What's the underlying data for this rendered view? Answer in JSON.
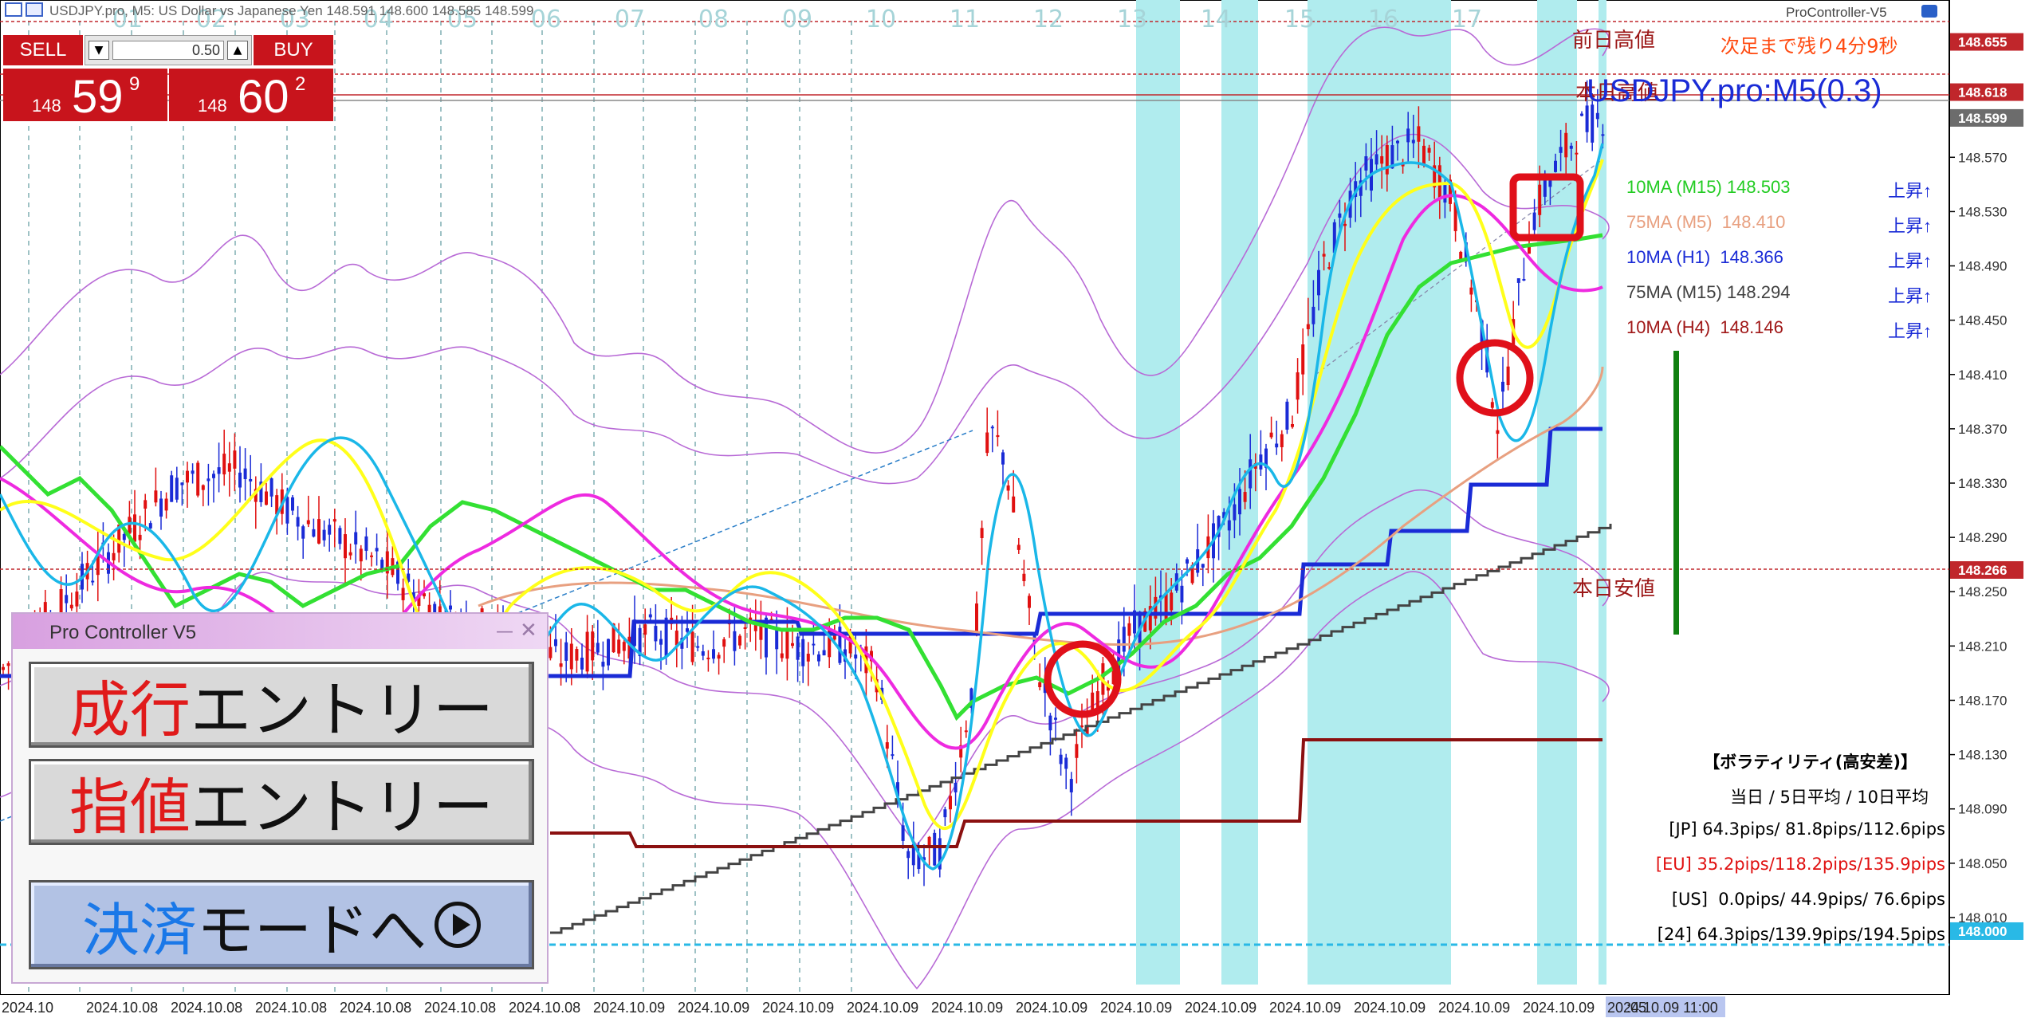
{
  "window": {
    "title_bar": "USDJPY.pro, M5: US Dollar vs Japanese Yen  148.591 148.600 148.585 148.599",
    "indicator_name": "ProController-V5"
  },
  "symbol_label": "USDJPY.pro:M5(0.3)",
  "countdown": "次足まで残り4分9秒",
  "trade_panel": {
    "sell_label": "SELL",
    "buy_label": "BUY",
    "lot": "0.50",
    "sell_price_big": "148",
    "sell_price_main": "59",
    "sell_price_sup": "9",
    "buy_price_big": "148",
    "buy_price_main": "60",
    "buy_price_sup": "2"
  },
  "controller": {
    "title": "Pro Controller V5",
    "btn1_red": "成行",
    "btn1_black": "エントリー",
    "btn2_red": "指値",
    "btn2_black": "エントリー",
    "btn3_blue": "決済",
    "btn3_black": "モードへ"
  },
  "levels": {
    "prev_day_high_label": "前日高値",
    "today_high_label": "本日高値",
    "today_low_label": "本日安値"
  },
  "ma_list": [
    {
      "label": "10MA (M15) 148.503",
      "status": "上昇↑",
      "color": "#22cc22"
    },
    {
      "label": "75MA (M5)  148.410",
      "status": "上昇↑",
      "color": "#e8a080"
    },
    {
      "label": "10MA (H1)  148.366",
      "status": "上昇↑",
      "color": "#1a2bd6"
    },
    {
      "label": "75MA (M15) 148.294",
      "status": "上昇↑",
      "color": "#404040"
    },
    {
      "label": "10MA (H4)  148.146",
      "status": "上昇↑",
      "color": "#a01818"
    }
  ],
  "volatility": {
    "title": "【ボラティリティ(高安差)】",
    "header": "当日 / 5日平均 / 10日平均",
    "rows": [
      {
        "text": "[JP] 64.3pips/ 81.8pips/112.6pips",
        "color": "#000000"
      },
      {
        "text": "[EU] 35.2pips/118.2pips/135.9pips",
        "color": "#e01010"
      },
      {
        "text": "[US]  0.0pips/ 44.9pips/ 76.6pips",
        "color": "#000000"
      },
      {
        "text": "[24] 64.3pips/139.9pips/194.5pips",
        "color": "#000000"
      }
    ]
  },
  "chart_data": {
    "type": "line",
    "title": "USDJPY.pro:M5(0.3)",
    "ylim": [
      147.99,
      148.67
    ],
    "y_ticks": [
      "148.570",
      "148.530",
      "148.490",
      "148.450",
      "148.410",
      "148.370",
      "148.330",
      "148.290",
      "148.250",
      "148.210",
      "148.170",
      "148.130",
      "148.090",
      "148.050",
      "148.010"
    ],
    "price_tags": [
      {
        "value": "148.655",
        "bg": "#c0262b"
      },
      {
        "value": "148.618",
        "bg": "#c0262b"
      },
      {
        "value": "148.599",
        "bg": "#6c6c6c"
      },
      {
        "value": "148.266",
        "bg": "#c0262b"
      },
      {
        "value": "148.000",
        "bg": "#29b9e6"
      }
    ],
    "hour_labels": [
      "01",
      "02",
      "03",
      "04",
      "05",
      "06",
      "07",
      "08",
      "09",
      "10",
      "11",
      "12",
      "13",
      "14",
      "15",
      "16",
      "17"
    ],
    "x_dates": [
      "2024.10",
      "2024.10.08",
      "2024.10.08",
      "2024.10.08",
      "2024.10.08",
      "2024.10.08",
      "2024.10.08",
      "2024.10.09",
      "2024.10.09",
      "2024.10.09",
      "2024.10.09",
      "2024.10.09",
      "2024.10.09",
      "2024.10.09",
      "2024.10.09",
      "2024.10.09",
      "2024.10.09",
      "2024.10.09",
      "2024.10.09",
      "2024.10.09 11:00"
    ],
    "x_tail": ":05",
    "series": [
      {
        "name": "10MA (M15)",
        "color": "#22dd22",
        "x": [
          0,
          20,
          40,
          60,
          80,
          100,
          120,
          140,
          160,
          180,
          200,
          220,
          230
        ],
        "y": [
          148.2,
          148.24,
          148.3,
          148.25,
          148.22,
          148.21,
          148.26,
          148.32,
          148.37,
          148.45,
          148.52,
          148.5,
          148.51
        ]
      },
      {
        "name": "75MA (M5)",
        "color": "#e8a080",
        "x": [
          70,
          100,
          130,
          160,
          190,
          200,
          230
        ],
        "y": [
          148.25,
          148.24,
          148.22,
          148.21,
          148.24,
          148.33,
          148.41
        ]
      },
      {
        "name": "10MA (H1)",
        "color": "#1a2bd6",
        "x": [
          0,
          40,
          80,
          120,
          160,
          180,
          200,
          215,
          230
        ],
        "y": [
          148.21,
          148.2,
          148.22,
          148.23,
          148.26,
          148.29,
          148.31,
          148.34,
          148.37
        ]
      },
      {
        "name": "75MA (M15)",
        "color": "#444444",
        "x": [
          70,
          100,
          130,
          160,
          190,
          210,
          230
        ],
        "y": [
          148.01,
          148.06,
          148.12,
          148.18,
          148.23,
          148.27,
          148.29
        ]
      },
      {
        "name": "10MA (H4)",
        "color": "#8b1010",
        "x": [
          70,
          90,
          100,
          150,
          160,
          230
        ],
        "y": [
          148.09,
          148.08,
          148.09,
          148.09,
          148.15,
          148.15
        ]
      }
    ]
  }
}
